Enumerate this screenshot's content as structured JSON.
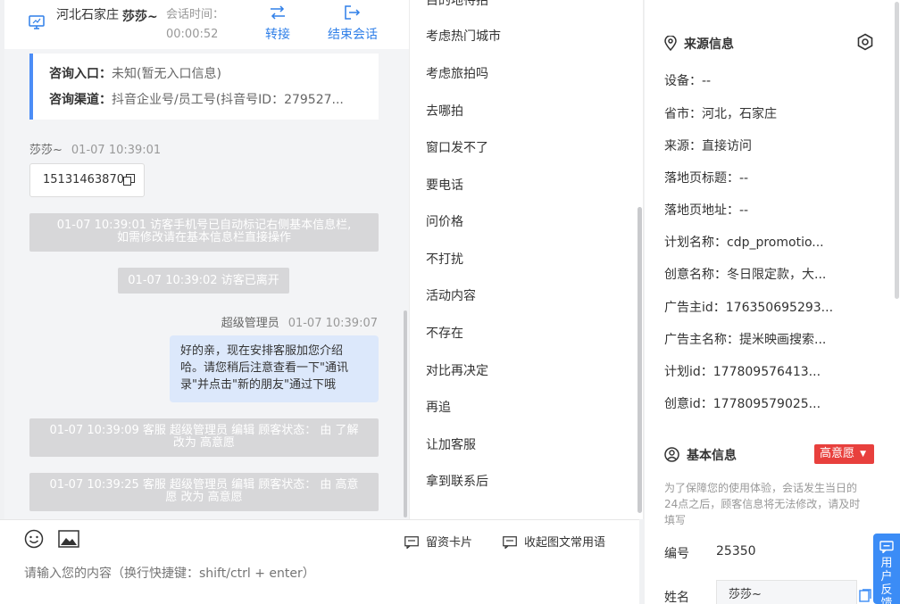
{
  "header": {
    "location": "河北石家庄",
    "visitor_name": "莎莎~",
    "time_label": "会话时间：",
    "time_value": "00:00:52",
    "transfer_label": "转接",
    "end_label": "结束会话"
  },
  "info_card": {
    "entry_label": "咨询入口：",
    "entry_value": "未知(暂无入口信息)",
    "channel_label": "咨询渠道：",
    "channel_value": "抖音企业号/员工号(抖音号ID：279527..."
  },
  "messages": {
    "visitor_name": "莎莎~",
    "visitor_time": "01-07 10:39:01",
    "phone": "15131463870",
    "sys1_line1": "01-07 10:39:01 访客手机号已自动标记右侧基本信息栏,",
    "sys1_line2": "如需修改请在基本信息栏直接操作",
    "sys2": "01-07 10:39:02 访客已离开",
    "agent_name": "超级管理员",
    "agent_time": "01-07 10:39:07",
    "agent_line1": "好的亲，现在安排客服加您介绍",
    "agent_line2": "哈。请您稍后注意查看一下\"通讯",
    "agent_line3": "录\"并点击\"新的朋友\"通过下哦",
    "sys3_line1": "01-07 10:39:09 客服 超级管理员 编辑 顾客状态：  由 了解",
    "sys3_line2": "改为 高意愿",
    "sys4_line1": "01-07 10:39:25 客服 超级管理员 编辑 顾客状态：  由 高意",
    "sys4_line2": "愿 改为 高意愿"
  },
  "composer": {
    "card_label": "留资卡片",
    "collapse_label": "收起图文常用语",
    "placeholder": "请输入您的内容（换行快捷键：shift/ctrl + enter）"
  },
  "phrases": [
    "目的地待拍",
    "考虑热门城市",
    "考虑旅拍吗",
    "去哪拍",
    "窗口发不了",
    "要电话",
    "问价格",
    "不打扰",
    "活动内容",
    "不存在",
    "对比再决定",
    "再追",
    "让加客服",
    "拿到联系后"
  ],
  "source_info": {
    "title": "来源信息",
    "device": "设备：--",
    "province_city": "省市：河北，石家庄",
    "source": "来源：直接访问",
    "landing_title": "落地页标题：--",
    "landing_url": "落地页地址：--",
    "plan_name": "计划名称：cdp_promotio...",
    "creative_name": "创意名称：冬日限定款，大...",
    "advertiser_id": "广告主id：176350695293...",
    "advertiser_name": "广告主名称：提米映画搜索...",
    "plan_id": "计划id：177809576413...",
    "creative_id": "创意id：177809579025..."
  },
  "basic_info": {
    "title": "基本信息",
    "intent_badge": "高意愿",
    "notice": "为了保障您的使用体验，会话发生当日的24点之后，顾客信息将无法修改，请及时填写",
    "number_label": "编号",
    "number_value": "25350",
    "name_label": "姓名",
    "name_value": "莎莎~"
  },
  "feedback": {
    "label": "用户反馈"
  },
  "colors": {
    "accent_blue": "#2f7fe8",
    "badge_red": "#e8403d",
    "agent_bubble": "#dce8fb",
    "system_msg": "#d7d7d9"
  }
}
